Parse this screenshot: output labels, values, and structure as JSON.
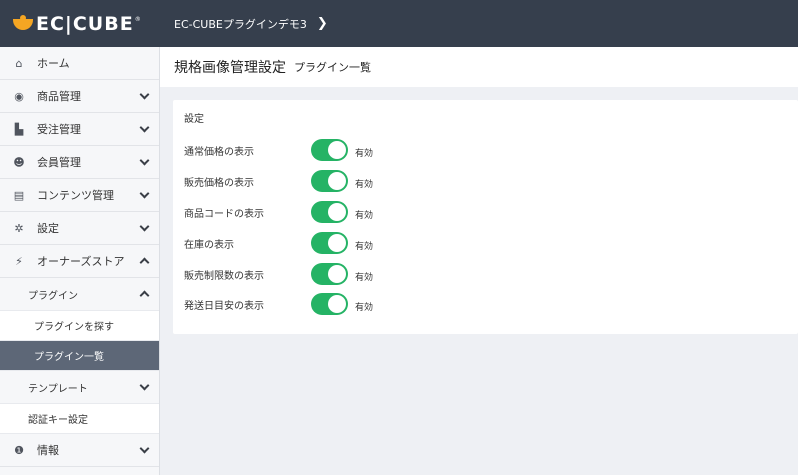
{
  "header": {
    "logo_text": "EC|CUBE",
    "logo_reg": "®",
    "shop_name": "EC-CUBEプラグインデモ3",
    "chevron": "❯"
  },
  "sidebar": {
    "items": [
      {
        "label": "ホーム",
        "icon": "home-icon",
        "glyph": "⌂"
      },
      {
        "label": "商品管理",
        "icon": "cube-icon",
        "glyph": "◉"
      },
      {
        "label": "受注管理",
        "icon": "cart-icon",
        "glyph": "▙"
      },
      {
        "label": "会員管理",
        "icon": "users-icon",
        "glyph": "☻"
      },
      {
        "label": "コンテンツ管理",
        "icon": "file-icon",
        "glyph": "▤"
      },
      {
        "label": "設定",
        "icon": "gear-icon",
        "glyph": "✲"
      },
      {
        "label": "オーナーズストア",
        "icon": "plug-icon",
        "glyph": "⚡"
      }
    ],
    "owners_store": {
      "plugin": "プラグイン",
      "plugin_children": [
        "プラグインを探す",
        "プラグイン一覧"
      ],
      "template": "テンプレート",
      "auth_key": "認証キー設定"
    },
    "info": {
      "label": "情報",
      "icon": "info-icon",
      "glyph": "❶"
    }
  },
  "page": {
    "title": "規格画像管理設定",
    "subtitle": "プラグイン一覧"
  },
  "settings": {
    "title": "設定",
    "rows": [
      {
        "label": "通常価格の表示",
        "state": "有効",
        "on": true
      },
      {
        "label": "販売価格の表示",
        "state": "有効",
        "on": true
      },
      {
        "label": "商品コードの表示",
        "state": "有効",
        "on": true
      },
      {
        "label": "在庫の表示",
        "state": "有効",
        "on": true
      },
      {
        "label": "販売制限数の表示",
        "state": "有効",
        "on": true
      },
      {
        "label": "発送日目安の表示",
        "state": "有効",
        "on": true
      }
    ]
  },
  "colors": {
    "topbar": "#363f4d",
    "accent": "#f5a623",
    "toggle_on": "#25b365",
    "active_nav": "#5d6777"
  }
}
